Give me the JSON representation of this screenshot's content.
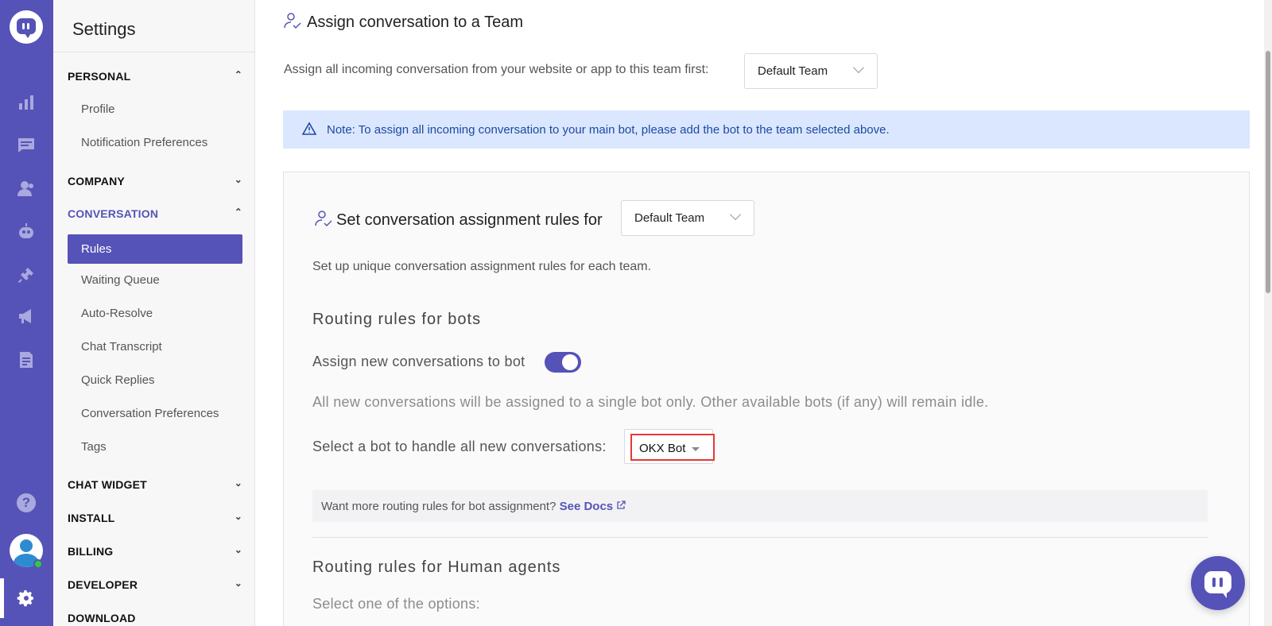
{
  "colors": {
    "brand": "#5553b7",
    "note_bg": "#dbe7ff",
    "note_text": "#1c4aa0",
    "highlight": "#e53935",
    "online": "#2ecc40"
  },
  "rail": {
    "icons": [
      "chat-logo-icon",
      "reports-icon",
      "conversations-icon",
      "contacts-icon",
      "bot-icon",
      "integrations-icon",
      "campaigns-icon",
      "knowledge-base-icon",
      "help-icon",
      "avatar",
      "settings-gear-icon"
    ],
    "help_label": "?"
  },
  "sidebar": {
    "title": "Settings",
    "personal": {
      "label": "PERSONAL",
      "items": [
        "Profile",
        "Notification Preferences"
      ]
    },
    "company": {
      "label": "COMPANY"
    },
    "conversation": {
      "label": "CONVERSATION",
      "items": [
        "Rules",
        "Waiting Queue",
        "Auto-Resolve",
        "Chat Transcript",
        "Quick Replies",
        "Conversation Preferences",
        "Tags"
      ]
    },
    "chat_widget": {
      "label": "CHAT WIDGET"
    },
    "install": {
      "label": "INSTALL"
    },
    "billing": {
      "label": "BILLING"
    },
    "developer": {
      "label": "DEVELOPER"
    },
    "download": {
      "label": "DOWNLOAD"
    }
  },
  "main": {
    "heading": "Assign conversation to a Team",
    "assign_text": "Assign all incoming conversation from your website or app to this team first:",
    "team_dropdown": "Default Team",
    "note": "Note: To assign all incoming conversation to your main bot, please add the bot to the team selected above.",
    "panel": {
      "heading": "Set conversation assignment rules for",
      "team_dropdown": "Default Team",
      "subtitle": "Set up unique conversation assignment rules for each team.",
      "bots_heading": "Routing rules for bots",
      "assign_bot_label": "Assign new conversations to bot",
      "assign_bot_enabled": true,
      "single_bot_note": "All new conversations will be assigned to a single bot only. Other available bots (if any) will remain idle.",
      "select_bot_label": "Select a bot to handle all new conversations:",
      "selected_bot": "OKX Bot",
      "docs_text": "Want more routing rules for bot assignment?",
      "docs_link": "See Docs",
      "human_heading": "Routing rules for Human agents",
      "options_label": "Select one of the options:"
    }
  }
}
